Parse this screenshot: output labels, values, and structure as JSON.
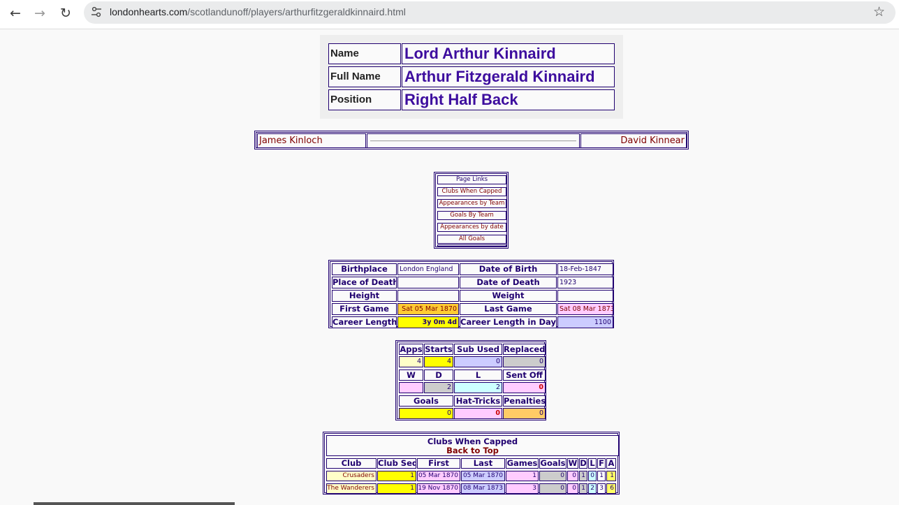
{
  "browser": {
    "url_host": "londonhearts.com",
    "url_path": "/scotlandunoff/players/arthurfitzgeraldkinnaird.html",
    "back_icon": "arrow-left-icon",
    "forward_icon": "arrow-right-icon",
    "reload_icon": "reload-icon",
    "site_info_icon": "tune-icon",
    "bookmark_icon": "star-icon"
  },
  "player": {
    "name_label": "Name",
    "name": "Lord Arthur Kinnaird",
    "full_name_label": "Full Name",
    "full_name": "Arthur Fitzgerald Kinnaird",
    "position_label": "Position",
    "position": "Right Half Back"
  },
  "nav": {
    "prev": "James Kinloch",
    "next": "David Kinnear"
  },
  "page_links": {
    "title": "Page Links",
    "items": [
      "Clubs When Capped",
      "Appearances by Team",
      "Goals By Team",
      "Appearances by date",
      "All Goals"
    ]
  },
  "bio": {
    "birthplace_label": "Birthplace",
    "birthplace": "London England",
    "dob_label": "Date of Birth",
    "dob": "18-Feb-1847",
    "pod_label": "Place of Death",
    "pod": "",
    "dod_label": "Date of Death",
    "dod": "1923",
    "height_label": "Height",
    "height": "",
    "weight_label": "Weight",
    "weight": "",
    "first_game_label": "First Game",
    "first_game": "Sat 05 Mar 1870",
    "last_game_label": "Last Game",
    "last_game": "Sat 08 Mar 1873",
    "career_length_label": "Career Length",
    "career_length": "3y 0m 4d",
    "career_days_label": "Career Length in Days",
    "career_days": "1100"
  },
  "stats": {
    "apps_label": "Apps",
    "starts_label": "Starts",
    "sub_used_label": "Sub Used",
    "replaced_label": "Replaced",
    "apps": "4",
    "starts": "4",
    "sub_used": "0",
    "replaced": "0",
    "w_label": "W",
    "d_label": "D",
    "l_label": "L",
    "sent_off_label": "Sent Off",
    "w": "",
    "d": "2",
    "l": "2",
    "sent_off": "0",
    "goals_label": "Goals",
    "hat_tricks_label": "Hat-Tricks",
    "penalties_label": "Penalties",
    "goals": "0",
    "hat_tricks": "0",
    "penalties": "0"
  },
  "clubs_capped": {
    "title": "Clubs When Capped",
    "back_to_top": "Back to Top",
    "headers": [
      "Club",
      "Club Seq",
      "First",
      "Last",
      "Games",
      "Goals",
      "W",
      "D",
      "L",
      "F",
      "A"
    ],
    "rows": [
      [
        "Crusaders",
        "1",
        "05 Mar 1870",
        "05 Mar 1870",
        "1",
        "0",
        "0",
        "1",
        "0",
        "1",
        "1"
      ],
      [
        "The Wanderers",
        "1",
        "19 Nov 1870",
        "08 Mar 1873",
        "3",
        "0",
        "0",
        "1",
        "2",
        "3",
        "6"
      ]
    ]
  },
  "colors": {
    "border": "#200070",
    "title_text": "#3d0d9e",
    "link_text": "#800000",
    "yellow": "#ffff00",
    "light_yellow": "#ffffc8",
    "lavender": "#ccccff",
    "pink": "#ffccff",
    "grey": "#cccccc",
    "cyan": "#ccffff",
    "orange": "#ffcc66",
    "gold": "#ffcc33"
  }
}
